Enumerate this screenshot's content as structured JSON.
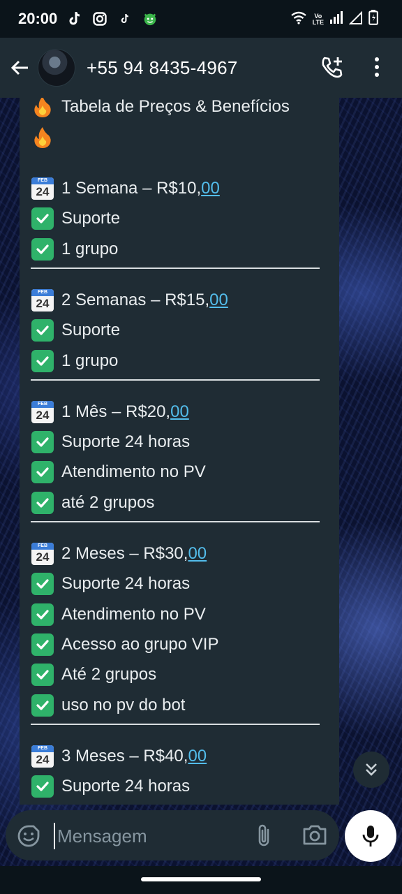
{
  "status_bar": {
    "time": "20:00",
    "volte_line1": "Vo",
    "volte_line2": "LTE",
    "left_icons": [
      "tiktok-icon",
      "instagram-icon",
      "tiktok-icon",
      "emoji-app-icon"
    ],
    "right_icons": [
      "wifi-icon",
      "volte-icon",
      "signal-icon",
      "signal-empty-icon",
      "battery-charging-icon"
    ]
  },
  "header": {
    "contact_name": "+55 94 8435-4967",
    "icons": [
      "back-arrow-icon",
      "avatar",
      "add-call-icon",
      "more-vert-icon"
    ]
  },
  "message": {
    "title": "Tabela de Preços & Benefícios",
    "plans": [
      {
        "name_prefix": "1 Semana – R$10,",
        "price_cents": "00",
        "benefits": [
          "Suporte",
          "1 grupo"
        ]
      },
      {
        "name_prefix": "2 Semanas – R$15,",
        "price_cents": "00",
        "benefits": [
          "Suporte",
          "1 grupo"
        ]
      },
      {
        "name_prefix": "1 Mês – R$20,",
        "price_cents": "00",
        "benefits": [
          "Suporte 24 horas",
          "Atendimento no PV",
          "até 2 grupos"
        ]
      },
      {
        "name_prefix": "2 Meses – R$30,",
        "price_cents": "00",
        "benefits": [
          "Suporte 24 horas",
          "Atendimento no PV",
          "Acesso ao grupo VIP",
          "Até 2 grupos",
          "uso no pv do bot"
        ]
      },
      {
        "name_prefix": "3 Meses – R$40,",
        "price_cents": "00",
        "benefits": [
          "Suporte 24 horas"
        ]
      }
    ],
    "calendar_month": "FEB",
    "calendar_day": "24"
  },
  "composer": {
    "placeholder": "Mensagem",
    "icons": [
      "emoji-icon",
      "attach-icon",
      "camera-icon",
      "mic-icon"
    ]
  },
  "colors": {
    "bubble": "#1f2c34",
    "header": "#1f2c34",
    "link": "#53bdeb",
    "check": "#2fb26a"
  }
}
